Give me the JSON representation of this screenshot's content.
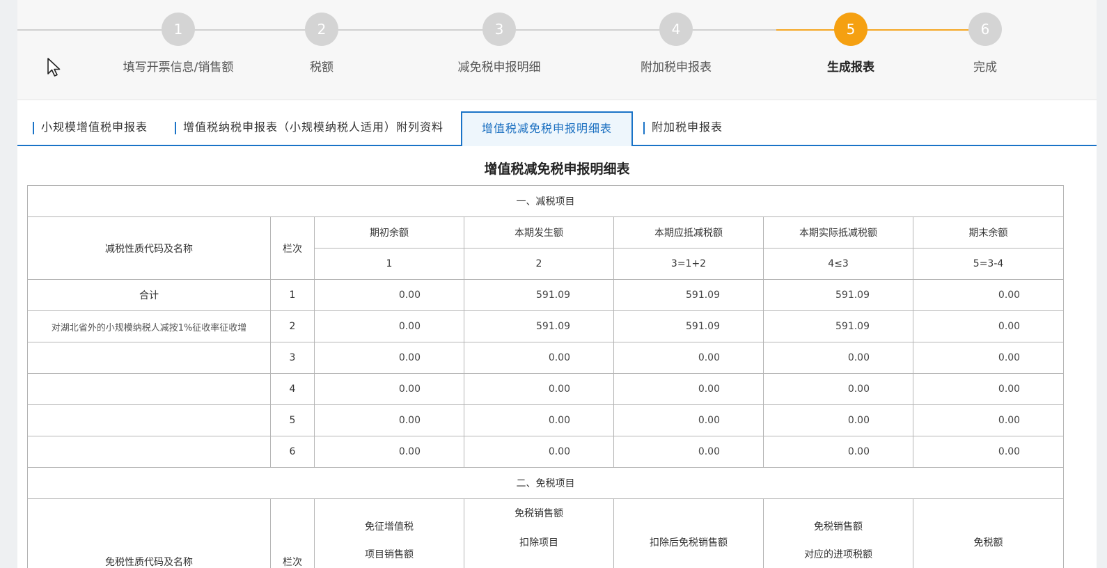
{
  "stepper": {
    "steps": [
      {
        "num": "1",
        "label": "填写开票信息/销售额"
      },
      {
        "num": "2",
        "label": "税额"
      },
      {
        "num": "3",
        "label": "减免税申报明细"
      },
      {
        "num": "4",
        "label": "附加税申报表"
      },
      {
        "num": "5",
        "label": "生成报表"
      },
      {
        "num": "6",
        "label": "完成"
      }
    ],
    "active_index": 4,
    "colors": {
      "active": "#f5a011",
      "inactive": "#d4d4d4",
      "progress_line": "#f5a623"
    }
  },
  "tabs": [
    {
      "label": "小规模增值税申报表"
    },
    {
      "label": "增值税纳税申报表（小规模纳税人适用）附列资料"
    },
    {
      "label": "增值税减免税申报明细表"
    },
    {
      "label": "附加税申报表"
    }
  ],
  "form": {
    "title": "增值税减免税申报明细表",
    "section1": "一、减税项目",
    "header": {
      "code_name": "减税性质代码及名称",
      "row_no": "栏次",
      "cols": [
        "期初余额",
        "本期发生额",
        "本期应抵减税额",
        "本期实际抵减税额",
        "期末余额"
      ],
      "formulas": [
        "1",
        "2",
        "3=1+2",
        "4≤3",
        "5=3-4"
      ]
    },
    "rows": [
      {
        "name": "合计",
        "no": "1",
        "values": [
          "0.00",
          "591.09",
          "591.09",
          "591.09",
          "0.00"
        ]
      },
      {
        "name": "对湖北省外的小规模纳税人减按1%征收率征收增",
        "no": "2",
        "values": [
          "0.00",
          "591.09",
          "591.09",
          "591.09",
          "0.00"
        ]
      },
      {
        "name": "",
        "no": "3",
        "values": [
          "0.00",
          "0.00",
          "0.00",
          "0.00",
          "0.00"
        ]
      },
      {
        "name": "",
        "no": "4",
        "values": [
          "0.00",
          "0.00",
          "0.00",
          "0.00",
          "0.00"
        ]
      },
      {
        "name": "",
        "no": "5",
        "values": [
          "0.00",
          "0.00",
          "0.00",
          "0.00",
          "0.00"
        ]
      },
      {
        "name": "",
        "no": "6",
        "values": [
          "0.00",
          "0.00",
          "0.00",
          "0.00",
          "0.00"
        ]
      }
    ],
    "section2": "二、免税项目",
    "header2": {
      "code_name": "免税性质代码及名称",
      "row_no": "栏次",
      "col1a": "免征增值税",
      "col1b": "项目销售额",
      "col2a": "免税销售额",
      "col2b": "扣除项目",
      "col3": "扣除后免税销售额",
      "col4a": "免税销售额",
      "col4b": "对应的进项税额",
      "col5": "免税额"
    }
  }
}
